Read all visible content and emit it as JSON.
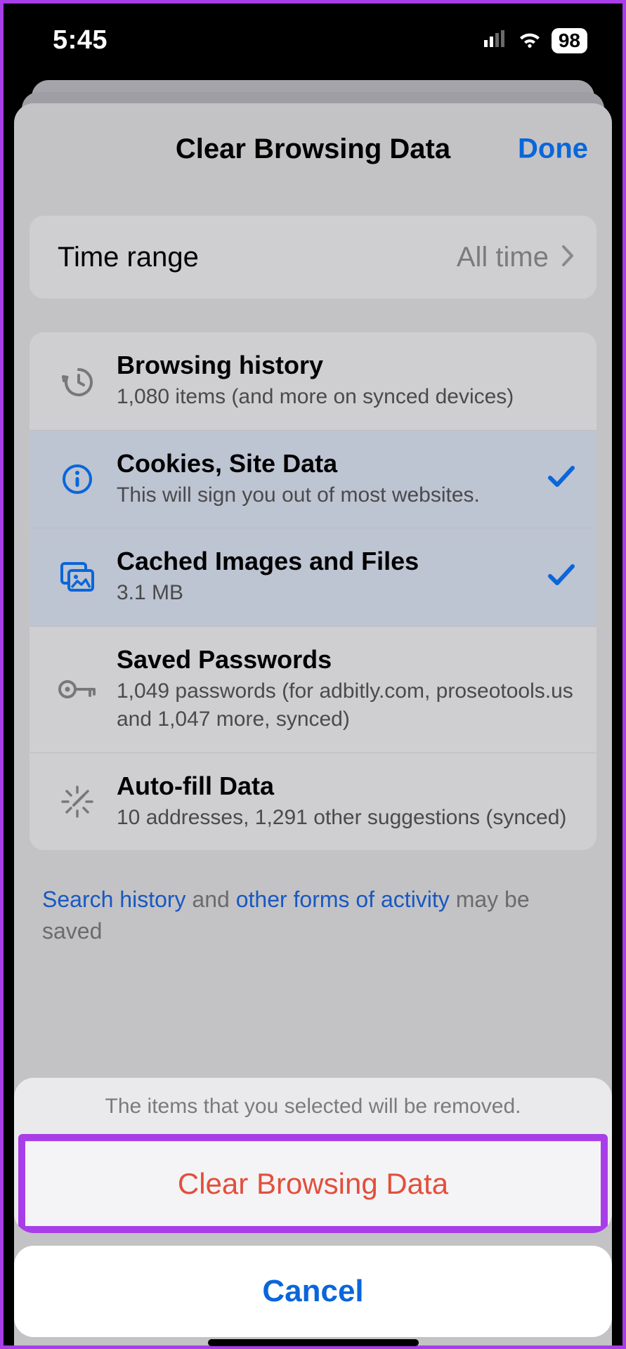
{
  "status": {
    "time": "5:45",
    "battery": "98"
  },
  "sheet": {
    "title": "Clear Browsing Data",
    "done": "Done",
    "time_range": {
      "label": "Time range",
      "value": "All time"
    },
    "items": [
      {
        "title": "Browsing history",
        "sub": "1,080 items (and more on synced devices)"
      },
      {
        "title": "Cookies, Site Data",
        "sub": "This will sign you out of most websites."
      },
      {
        "title": "Cached Images and Files",
        "sub": "3.1 MB"
      },
      {
        "title": "Saved Passwords",
        "sub": "1,049 passwords (for adbitly.com, proseotools.us and 1,047 more, synced)"
      },
      {
        "title": "Auto-fill Data",
        "sub": "10 addresses, 1,291 other suggestions (synced)"
      }
    ],
    "footer": {
      "link1": "Search history",
      "mid": " and ",
      "link2": "other forms of activity",
      "rest": " may be saved"
    }
  },
  "action_sheet": {
    "message": "The items that you selected will be removed.",
    "clear": "Clear Browsing Data",
    "cancel": "Cancel"
  }
}
